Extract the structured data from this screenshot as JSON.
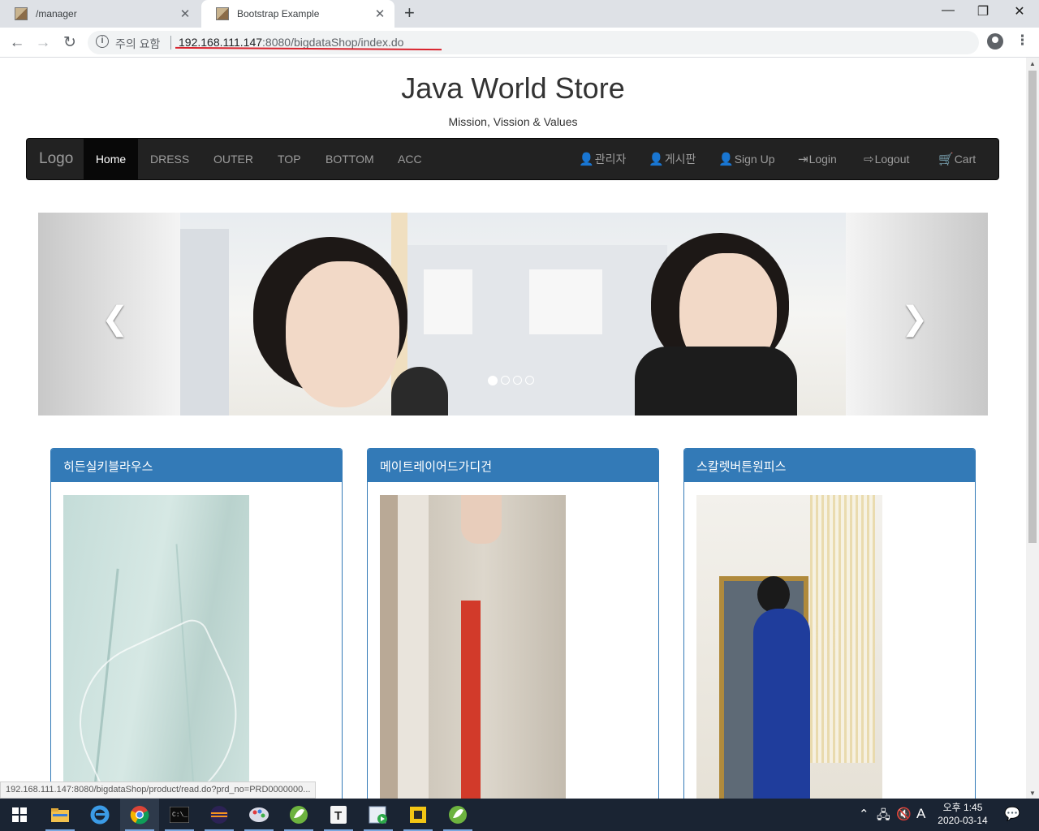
{
  "browser": {
    "tabs": [
      {
        "title": "/manager",
        "close": "✕"
      },
      {
        "title": "Bootstrap Example",
        "close": "✕"
      }
    ],
    "new_tab": "+",
    "window_controls": {
      "minimize": "—",
      "restore": "❐",
      "close": "✕"
    },
    "back": "←",
    "forward": "→",
    "reload": "↻",
    "security_label": "주의 요함",
    "info_glyph": "i",
    "url_host": "192.168.111.147",
    "url_rest": ":8080/bigdataShop/index.do",
    "bookmark_glyph": "☆",
    "menu_glyph": "⋮",
    "status_url": "192.168.111.147:8080/bigdataShop/product/read.do?prd_no=PRD0000000..."
  },
  "page": {
    "title": "Java World Store",
    "subtitle": "Mission, Vission & Values",
    "navbar": {
      "brand": "Logo",
      "left_items": [
        "Home",
        "DRESS",
        "OUTER",
        "TOP",
        "BOTTOM",
        "ACC"
      ],
      "active": "Home",
      "right_items": [
        {
          "icon": "user-icon",
          "glyph": "👤",
          "label": "관리자"
        },
        {
          "icon": "user-icon",
          "glyph": "👤",
          "label": "게시판"
        },
        {
          "icon": "user-icon",
          "glyph": "👤",
          "label": "Sign Up"
        },
        {
          "icon": "login-icon",
          "glyph": "⇥",
          "label": "Login"
        },
        {
          "icon": "logout-icon",
          "glyph": "⇨",
          "label": "Logout"
        },
        {
          "icon": "cart-icon",
          "glyph": "🛒",
          "label": "Cart"
        }
      ]
    },
    "carousel": {
      "prev": "❮",
      "next": "❯",
      "indicators": 4,
      "active_indicator": 0
    },
    "products": [
      {
        "name": "히든실키블라우스"
      },
      {
        "name": "메이트레이어드가디건"
      },
      {
        "name": "스칼렛버튼원피스"
      }
    ]
  },
  "taskbar": {
    "apps": [
      "start-icon",
      "file-explorer-icon",
      "internet-explorer-icon",
      "chrome-icon",
      "terminal-icon",
      "eclipse-icon",
      "paint-icon",
      "spring-tool-icon",
      "typora-icon",
      "media-icon",
      "app-icon",
      "spring-tool-icon"
    ],
    "tray": {
      "up": "⌃",
      "network": "🖧",
      "volume": "🔇",
      "ime": "A"
    },
    "clock_time": "오후 1:45",
    "clock_date": "2020-03-14",
    "notification_glyph": "💬"
  },
  "colors": {
    "primary": "#337ab7",
    "navbar": "#222222",
    "url_mark": "#d9232d",
    "taskbar": "#1a2433"
  }
}
